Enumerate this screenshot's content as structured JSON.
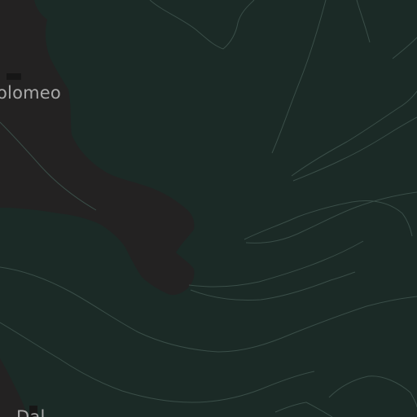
{
  "map": {
    "theme": "dark",
    "colors": {
      "water": "#1b2a26",
      "land": "#232222",
      "contour": "#3a4e48",
      "building": "#161616"
    },
    "labels": {
      "top_place": "olomeo",
      "bottom_place": "Dal"
    }
  }
}
